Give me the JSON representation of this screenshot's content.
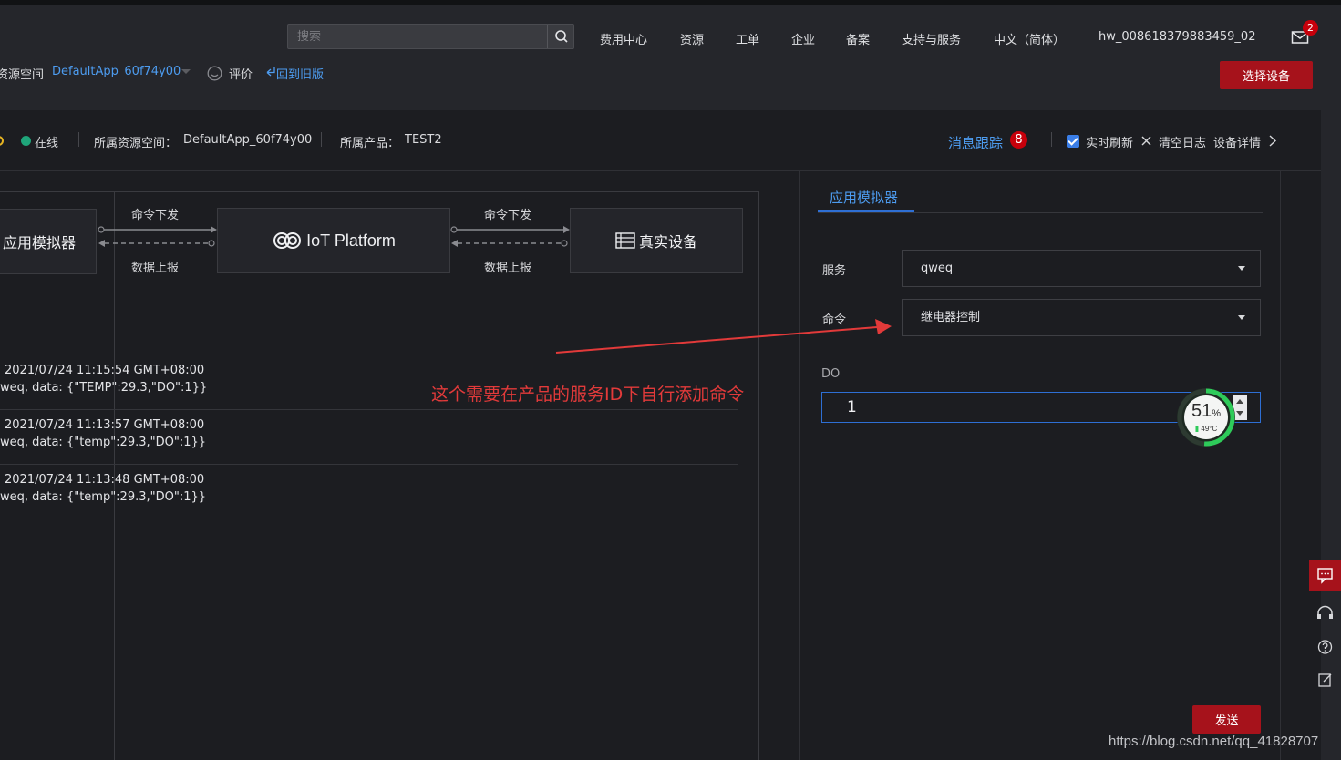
{
  "topbar": {
    "search_placeholder": "搜索",
    "nav": [
      "费用中心",
      "资源",
      "工单",
      "企业",
      "备案",
      "支持与服务",
      "中文（简体）",
      "hw_008618379883459_02"
    ],
    "mail_badge": "2"
  },
  "subbar": {
    "workspace_label": "资源空间",
    "workspace_value": "DefaultApp_60f74y00",
    "rate_label": "评价",
    "back_label": "回到旧版",
    "select_device_label": "选择设备"
  },
  "device_info": {
    "status": "在线",
    "space_label": "所属资源空间：",
    "space_value": "DefaultApp_60f74y00",
    "product_label": "所属产品：",
    "product_value": "TEST2",
    "track_label": "消息跟踪",
    "track_count": "8",
    "realtime_label": "实时刷新",
    "clear_label": "清空日志",
    "detail_label": "设备详情"
  },
  "flow": {
    "app_sim": "应用模拟器",
    "platform": "IoT Platform",
    "device": "真实设备",
    "cmd_down": "命令下发",
    "data_up": "数据上报"
  },
  "records": [
    {
      "time": "2021/07/24 11:15:54 GMT+08:00",
      "data": "weq, data: {\"TEMP\":29.3,\"DO\":1}}"
    },
    {
      "time": "2021/07/24 11:13:57 GMT+08:00",
      "data": "weq, data: {\"temp\":29.3,\"DO\":1}}"
    },
    {
      "time": "2021/07/24 11:13:48 GMT+08:00",
      "data": "weq, data: {\"temp\":29.3,\"DO\":1}}"
    }
  ],
  "annotation": "这个需要在产品的服务ID下自行添加命令",
  "simulator": {
    "tab": "应用模拟器",
    "service_label": "服务",
    "service_value": "qweq",
    "command_label": "命令",
    "command_value": "继电器控制",
    "do_label": "DO",
    "do_value": "1",
    "send_label": "发送"
  },
  "gauge": {
    "percent": "51",
    "percent_unit": "%",
    "temp": "49°C",
    "level": 0.51
  },
  "watermark": "https://blog.csdn.net/qq_41828707",
  "colors": {
    "accent": "#4d9cf0",
    "primary_button": "#a6121b",
    "online": "#1fa57a",
    "annotation": "#e23a3a"
  }
}
